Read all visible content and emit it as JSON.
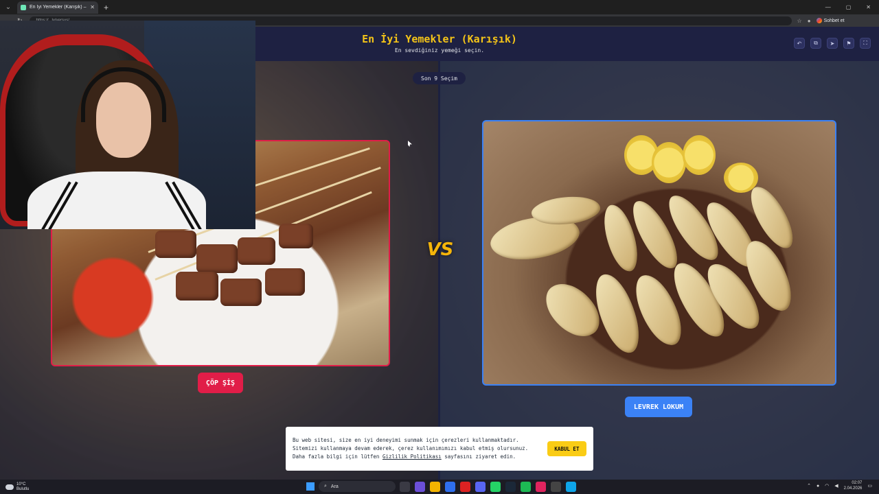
{
  "browser": {
    "tab_title": "En İyi Yemekler (Karışık) – Tier List",
    "url": "https://...ly/versus/...",
    "chat_label": "Sohbet et"
  },
  "page": {
    "title": "En İyi Yemekler (Karışık)",
    "subtitle": "En sevdiğiniz yemeği seçin.",
    "recent_label": "Son 9 Seçim",
    "vs_label": "VS",
    "left_option": "ÇÖP ŞİŞ",
    "right_option": "LEVREK LOKUM",
    "header_icons": [
      "undo-icon",
      "copy-icon",
      "send-icon",
      "flag-icon",
      "fullscreen-icon"
    ]
  },
  "cookie": {
    "text_before": "Bu web sitesi, size en iyi deneyimi sunmak için çerezleri kullanmaktadır. Sitemizi kullanmaya devam ederek, çerez kullanımımızı kabul etmiş olursunuz. Daha fazla bilgi için lütfen ",
    "link": "Gizlilik Politikası",
    "text_after": " sayfasını ziyaret edin.",
    "accept": "KABUL ET"
  },
  "taskbar": {
    "temp": "10°C",
    "condition": "Bulutlu",
    "search": "Ara",
    "time": "02:07",
    "date": "2.04.2026"
  },
  "colors": {
    "header_bg": "#1e2142",
    "title": "#f5c518",
    "left_accent": "#e11d48",
    "right_accent": "#3b82f6",
    "accept_btn": "#facc15"
  }
}
